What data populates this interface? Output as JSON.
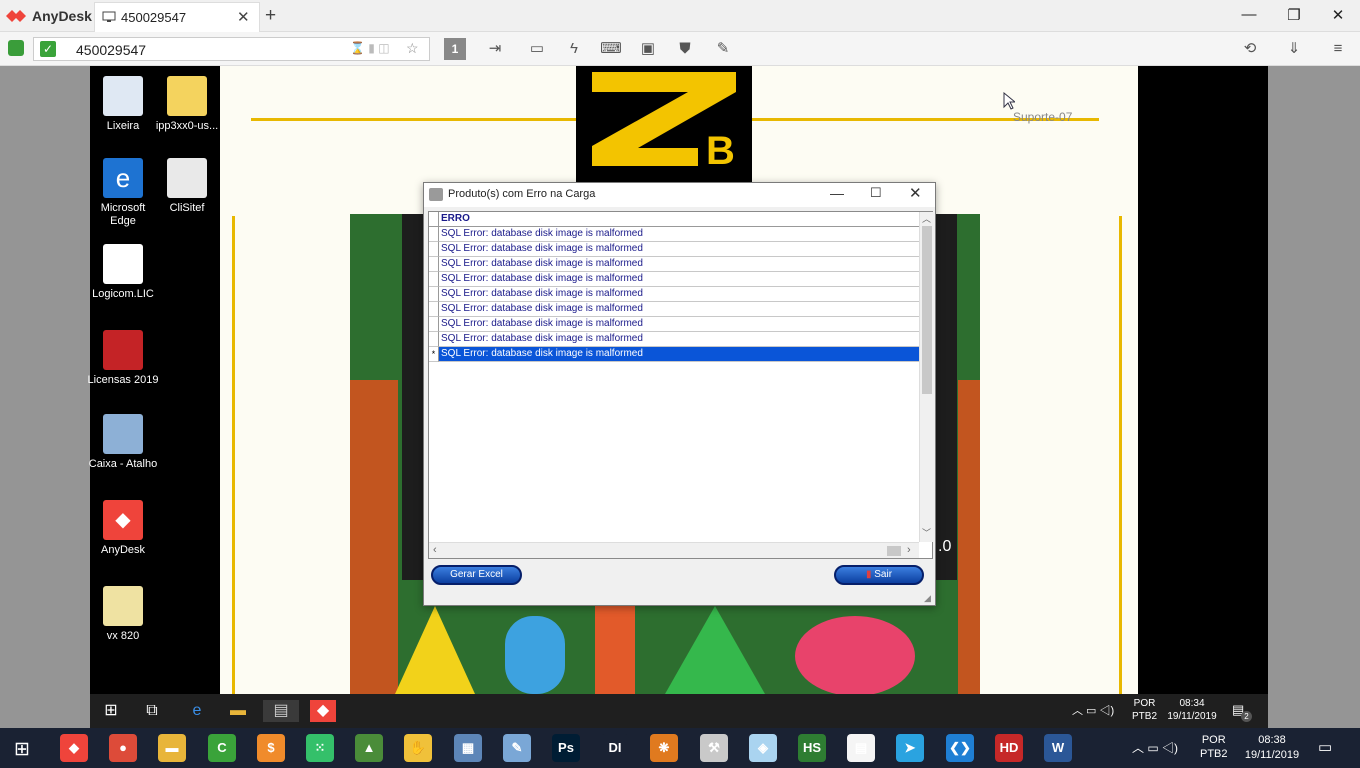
{
  "anydesk": {
    "app_name": "AnyDesk",
    "tab_label": "450029547",
    "address": "450029547",
    "monitor_number": "1",
    "accent": "#ef443b"
  },
  "desktop_icons": [
    {
      "label": "Lixeira",
      "color": "#dfe8f3"
    },
    {
      "label": "ipp3xx0-us...",
      "color": "#f4d35e"
    },
    {
      "label": "Microsoft Edge",
      "color": "#1e73d2"
    },
    {
      "label": "CliSitef",
      "color": "#e9e9e9"
    },
    {
      "label": "Logicom.LIC",
      "color": "#ffffff"
    },
    {
      "label": "Licensas 2019",
      "color": "#c42326"
    },
    {
      "label": "Caixa - Atalho",
      "color": "#8db0d6"
    },
    {
      "label": "AnyDesk",
      "color": "#ef443b"
    },
    {
      "label": "vx 820",
      "color": "#efe2a2"
    }
  ],
  "background": {
    "suporte_label": "Suporte-07",
    "version_fragment": ".0"
  },
  "dialog": {
    "title": "Produto(s) com Erro na Carga",
    "column_header": "ERRO",
    "rows": [
      "SQL Error: database disk image is malformed",
      "SQL Error: database disk image is malformed",
      "SQL Error: database disk image is malformed",
      "SQL Error: database disk image is malformed",
      "SQL Error: database disk image is malformed",
      "SQL Error: database disk image is malformed",
      "SQL Error: database disk image is malformed",
      "SQL Error: database disk image is malformed",
      "SQL Error: database disk image is malformed"
    ],
    "selected_row_marker": "*",
    "excel_button": "Gerar Excel",
    "exit_button": "Sair"
  },
  "remote_tray": {
    "lang1": "POR",
    "lang2": "PTB2",
    "time": "08:34",
    "date": "19/11/2019",
    "notif_count": "2"
  },
  "host_tray": {
    "lang1": "POR",
    "lang2": "PTB2",
    "time": "08:38",
    "date": "19/11/2019"
  },
  "host_taskbar_apps": [
    {
      "icon": "anydesk-icon",
      "color": "#ef443b",
      "text": "◆"
    },
    {
      "icon": "chrome-icon",
      "color": "#dd4b39",
      "text": "●"
    },
    {
      "icon": "file-explorer-icon",
      "color": "#e8b53a",
      "text": "▬"
    },
    {
      "icon": "camtasia-icon",
      "color": "#3aa33a",
      "text": "C"
    },
    {
      "icon": "orange-app-icon",
      "color": "#f08b2b",
      "text": "$"
    },
    {
      "icon": "dots-app-icon",
      "color": "#34c06a",
      "text": "⁙"
    },
    {
      "icon": "chart-app-icon",
      "color": "#4a8c39",
      "text": "▲"
    },
    {
      "icon": "hands-app-icon",
      "color": "#f0c13a",
      "text": "✋"
    },
    {
      "icon": "network-app-icon",
      "color": "#5d86b8",
      "text": "▦"
    },
    {
      "icon": "paint-icon",
      "color": "#7aa7d6",
      "text": "✎"
    },
    {
      "icon": "photoshop-icon",
      "color": "#001d34",
      "text": "Ps"
    },
    {
      "icon": "di-app-icon",
      "color": "#1a2233",
      "text": "DI"
    },
    {
      "icon": "orange-cluster-icon",
      "color": "#e07a1f",
      "text": "❋"
    },
    {
      "icon": "tools-app-icon",
      "color": "#c9c9c9",
      "text": "⚒"
    },
    {
      "icon": "box-app-icon",
      "color": "#aad4f0",
      "text": "◈"
    },
    {
      "icon": "hs-app-icon",
      "color": "#2e7d32",
      "text": "HS"
    },
    {
      "icon": "notepad-icon",
      "color": "#f5f5f5",
      "text": "▤"
    },
    {
      "icon": "telegram-icon",
      "color": "#2aa3e0",
      "text": "➤"
    },
    {
      "icon": "vscode-icon",
      "color": "#1f7fd4",
      "text": "❮❯"
    },
    {
      "icon": "hd-app-icon",
      "color": "#c62828",
      "text": "HD"
    },
    {
      "icon": "word-icon",
      "color": "#2b5797",
      "text": "W"
    }
  ]
}
